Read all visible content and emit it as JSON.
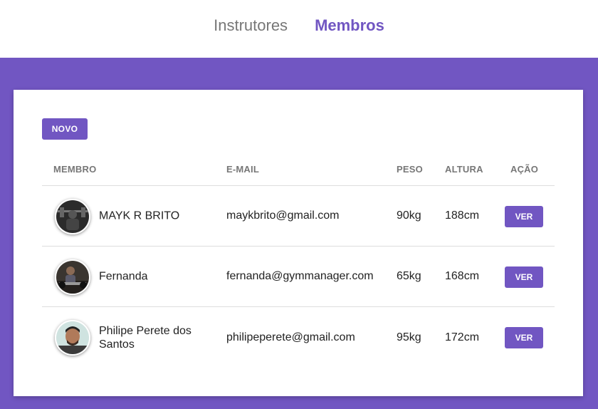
{
  "nav": {
    "instrutores": "Instrutores",
    "membros": "Membros"
  },
  "actions": {
    "novo": "NOVO"
  },
  "table": {
    "headers": {
      "membro": "MEMBRO",
      "email": "E-MAIL",
      "peso": "PESO",
      "altura": "ALTURA",
      "acao": "AÇÃO"
    },
    "rows": [
      {
        "name": "MAYK R BRITO",
        "email": "maykbrito@gmail.com",
        "peso": "90kg",
        "altura": "188cm",
        "action": "VER"
      },
      {
        "name": "Fernanda",
        "email": "fernanda@gymmanager.com",
        "peso": "65kg",
        "altura": "168cm",
        "action": "VER"
      },
      {
        "name": "Philipe Perete dos Santos",
        "email": "philipeperete@gmail.com",
        "peso": "95kg",
        "altura": "172cm",
        "action": "VER"
      }
    ]
  },
  "colors": {
    "accent": "#7156c2",
    "header_text": "#777777",
    "body_text": "#222222",
    "divider": "#dddddd"
  }
}
